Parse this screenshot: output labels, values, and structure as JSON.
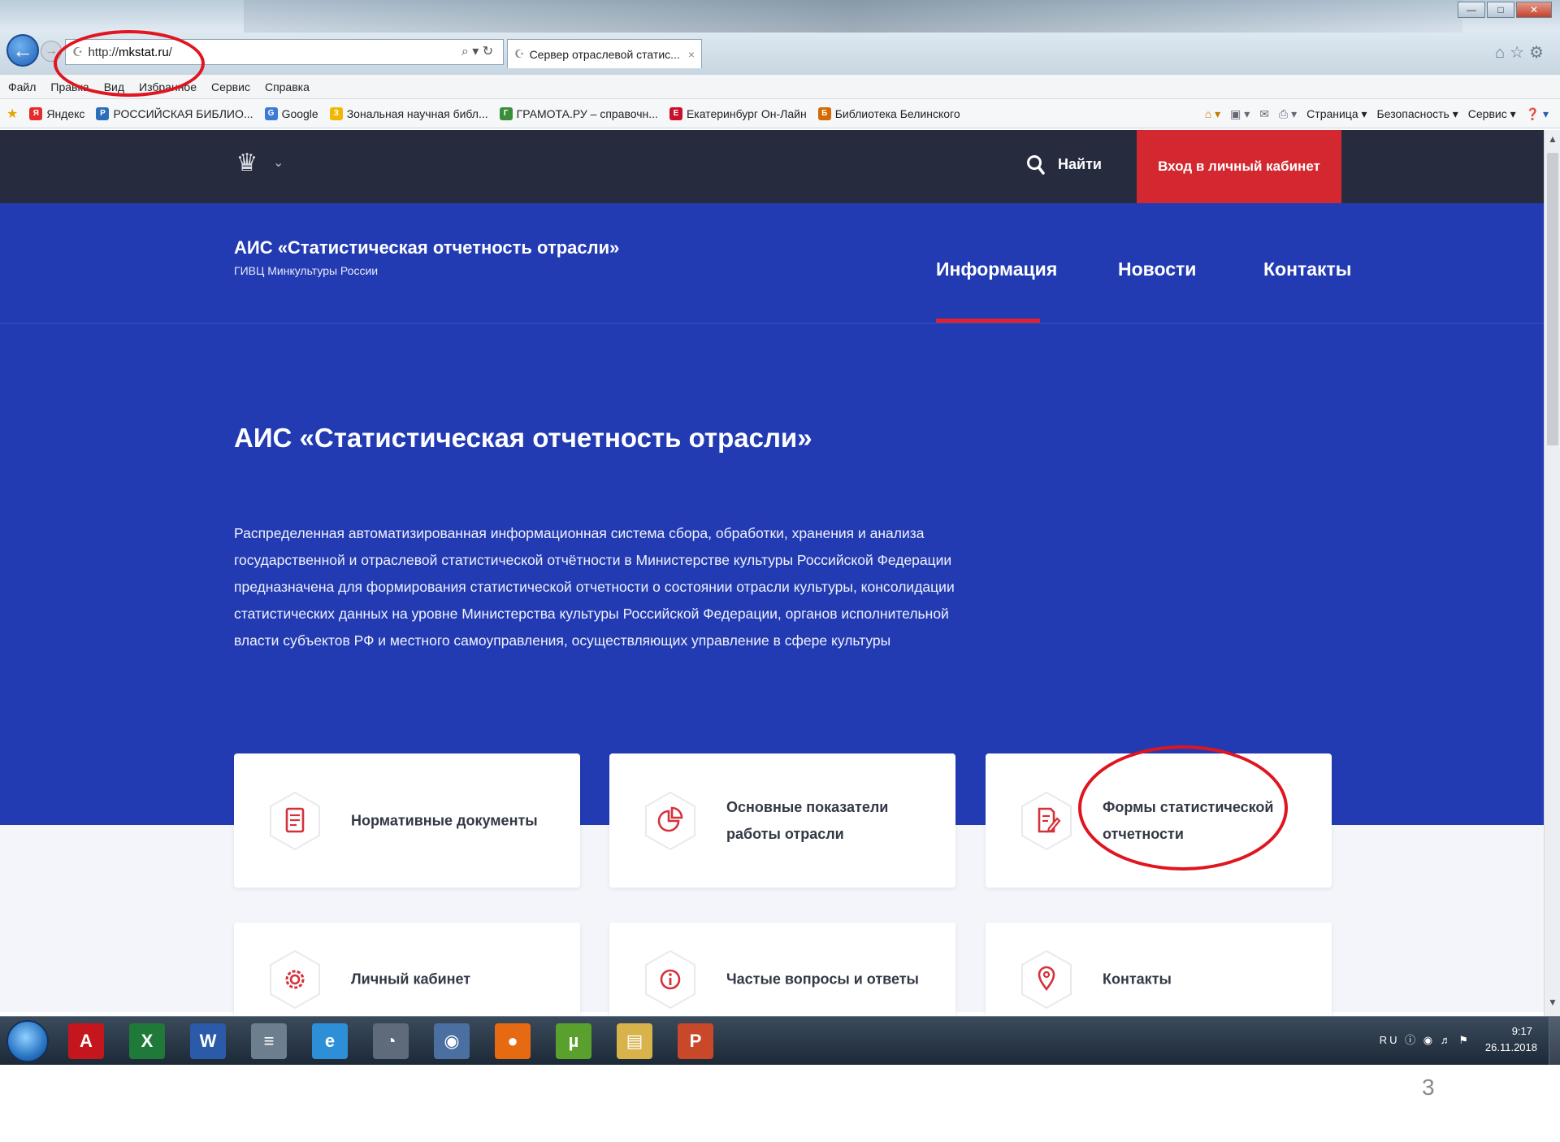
{
  "browser": {
    "address": {
      "prefix": "http://",
      "host": "mkstat.ru",
      "suffix": "/"
    },
    "address_controls": "⌕ ▾ ↻",
    "tab_title": "Сервер отраслевой статис...",
    "tab_close": "×",
    "menu": [
      "Файл",
      "Правка",
      "Вид",
      "Избранное",
      "Сервис",
      "Справка"
    ],
    "favorites": [
      {
        "label": "Яндекс",
        "color": "#e52b2b",
        "glyph": "Я"
      },
      {
        "label": "РОССИЙСКАЯ БИБЛИО...",
        "color": "#2a6ebc",
        "glyph": "Р"
      },
      {
        "label": "Google",
        "color": "#3b7ad6",
        "glyph": "G"
      },
      {
        "label": "Зональная научная библ...",
        "color": "#f2b705",
        "glyph": "З"
      },
      {
        "label": "ГРАМОТА.РУ – справочн...",
        "color": "#3a8e3a",
        "glyph": "Г"
      },
      {
        "label": "Екатеринбург Он-Лайн",
        "color": "#c8102e",
        "glyph": "Е"
      },
      {
        "label": "Библиотека Белинского",
        "color": "#d46a00",
        "glyph": "Б"
      }
    ],
    "commands": [
      "Страница ▾",
      "Безопасность ▾",
      "Сервис ▾"
    ]
  },
  "site": {
    "search_label": "Найти",
    "login_label": "Вход в личный кабинет",
    "brand_title": "АИС «Статистическая отчетность отрасли»",
    "brand_subtitle": "ГИВЦ Минкультуры России",
    "nav": [
      {
        "label": "Информация",
        "active": true
      },
      {
        "label": "Новости",
        "active": false
      },
      {
        "label": "Контакты",
        "active": false
      }
    ],
    "hero_title": "АИС «Статистическая отчетность отрасли»",
    "hero_description_lines": [
      "Распределенная автоматизированная информационная система сбора, обработки, хранения и анализа",
      "государственной и отраслевой статистической отчётности в Министерстве культуры Российской Федерации",
      "предназначена для формирования статистической отчетности о состоянии отрасли культуры, консолидации",
      "статистических данных на уровне Министерства культуры Российской Федерации, органов исполнительной",
      "власти субъектов РФ и местного самоуправления, осуществляющих управление в сфере культуры"
    ],
    "cards": [
      {
        "label": "Нормативные документы",
        "icon": "document-icon"
      },
      {
        "label": "Основные показатели работы отрасли",
        "icon": "chart-icon"
      },
      {
        "label": "Формы статистической отчетности",
        "icon": "form-edit-icon"
      },
      {
        "label": "Личный кабинет",
        "icon": "gear-icon"
      },
      {
        "label": "Частые вопросы и ответы",
        "icon": "info-icon"
      },
      {
        "label": "Контакты",
        "icon": "location-pin-icon"
      }
    ]
  },
  "taskbar": {
    "apps": [
      {
        "name": "acrobat-task-icon",
        "glyph": "A",
        "color": "#c4161c"
      },
      {
        "name": "excel-task-icon",
        "glyph": "X",
        "color": "#1f7a3a"
      },
      {
        "name": "word-task-icon",
        "glyph": "W",
        "color": "#2a5aa8"
      },
      {
        "name": "calculator-task-icon",
        "glyph": "≡",
        "color": "#6d7f8f"
      },
      {
        "name": "ie-task-icon",
        "glyph": "e",
        "color": "#2c8fd8"
      },
      {
        "name": "chrome-like-task-icon",
        "glyph": "◔",
        "color": "#5f6b7a"
      },
      {
        "name": "explorer-search-task-icon",
        "glyph": "◉",
        "color": "#4a6fa0"
      },
      {
        "name": "firefox-task-icon",
        "glyph": "●",
        "color": "#e66a12"
      },
      {
        "name": "utorrent-task-icon",
        "glyph": "µ",
        "color": "#5aa02c"
      },
      {
        "name": "folder-task-icon",
        "glyph": "▤",
        "color": "#d8b24a"
      },
      {
        "name": "powerpoint-task-icon",
        "glyph": "P",
        "color": "#c9482a"
      }
    ],
    "tray_lang": "RU",
    "clock_time": "9:17",
    "clock_date": "26.11.2018"
  },
  "slide_number": "3",
  "colors": {
    "topbar": "#262b3e",
    "hero": "#223bb3",
    "accent_red": "#d42830",
    "annotation": "#e0151f"
  }
}
